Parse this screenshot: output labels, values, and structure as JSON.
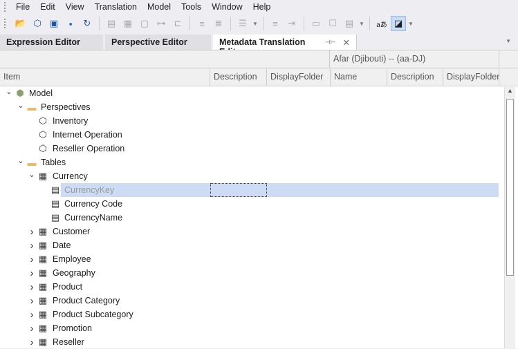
{
  "menu": [
    "File",
    "Edit",
    "View",
    "Translation",
    "Model",
    "Tools",
    "Window",
    "Help"
  ],
  "toolbar_icons": [
    "open-icon",
    "model-icon",
    "copy-icon",
    "save-icon",
    "refresh-icon",
    "|",
    "document-icon",
    "layout-icon",
    "new-file-icon",
    "hierarchy-icon",
    "script-icon",
    "|",
    "indent-icon",
    "outdent-icon",
    "|",
    "align-icon",
    "dd",
    "|",
    "center-icon",
    "import-icon",
    "|",
    "textbox-icon",
    "comment-icon",
    "form-icon",
    "dd",
    "|",
    "translate-icon",
    "edit-icon",
    "dd"
  ],
  "tabs": [
    {
      "label": "Expression Editor"
    },
    {
      "label": "Perspective Editor"
    },
    {
      "label": "Metadata Translation Editor",
      "pin": "⊣⊢",
      "close": "✕"
    }
  ],
  "grid": {
    "language": "Afar (Djibouti) -- (aa-DJ)",
    "columns": [
      "Item",
      "Description",
      "DisplayFolder",
      "Name",
      "Description",
      "DisplayFolder"
    ]
  },
  "tree": [
    {
      "label": "Model",
      "level": 0,
      "expand": "open",
      "icon": "model"
    },
    {
      "label": "Perspectives",
      "level": 1,
      "expand": "open",
      "icon": "folder"
    },
    {
      "label": "Inventory",
      "level": 2,
      "icon": "perspective"
    },
    {
      "label": "Internet Operation",
      "level": 2,
      "icon": "perspective"
    },
    {
      "label": "Reseller Operation",
      "level": 2,
      "icon": "perspective"
    },
    {
      "label": "Tables",
      "level": 1,
      "expand": "open",
      "icon": "folder"
    },
    {
      "label": "Currency",
      "level": 2,
      "expand": "open",
      "icon": "table"
    },
    {
      "label": "CurrencyKey",
      "level": 3,
      "icon": "column",
      "selected": true
    },
    {
      "label": "Currency Code",
      "level": 3,
      "icon": "column"
    },
    {
      "label": "CurrencyName",
      "level": 3,
      "icon": "column"
    },
    {
      "label": "Customer",
      "level": 2,
      "expand": "closed",
      "icon": "table"
    },
    {
      "label": "Date",
      "level": 2,
      "expand": "closed",
      "icon": "date-table"
    },
    {
      "label": "Employee",
      "level": 2,
      "expand": "closed",
      "icon": "table"
    },
    {
      "label": "Geography",
      "level": 2,
      "expand": "closed",
      "icon": "table"
    },
    {
      "label": "Product",
      "level": 2,
      "expand": "closed",
      "icon": "table"
    },
    {
      "label": "Product Category",
      "level": 2,
      "expand": "closed",
      "icon": "table"
    },
    {
      "label": "Product Subcategory",
      "level": 2,
      "expand": "closed",
      "icon": "table"
    },
    {
      "label": "Promotion",
      "level": 2,
      "expand": "closed",
      "icon": "table"
    },
    {
      "label": "Reseller",
      "level": 2,
      "expand": "closed",
      "icon": "table"
    }
  ],
  "colors": {
    "selection": "#cddcf4",
    "selected_text": "#9a9a9a",
    "folder": "#e8b86a",
    "accent": "#1c58a8"
  }
}
